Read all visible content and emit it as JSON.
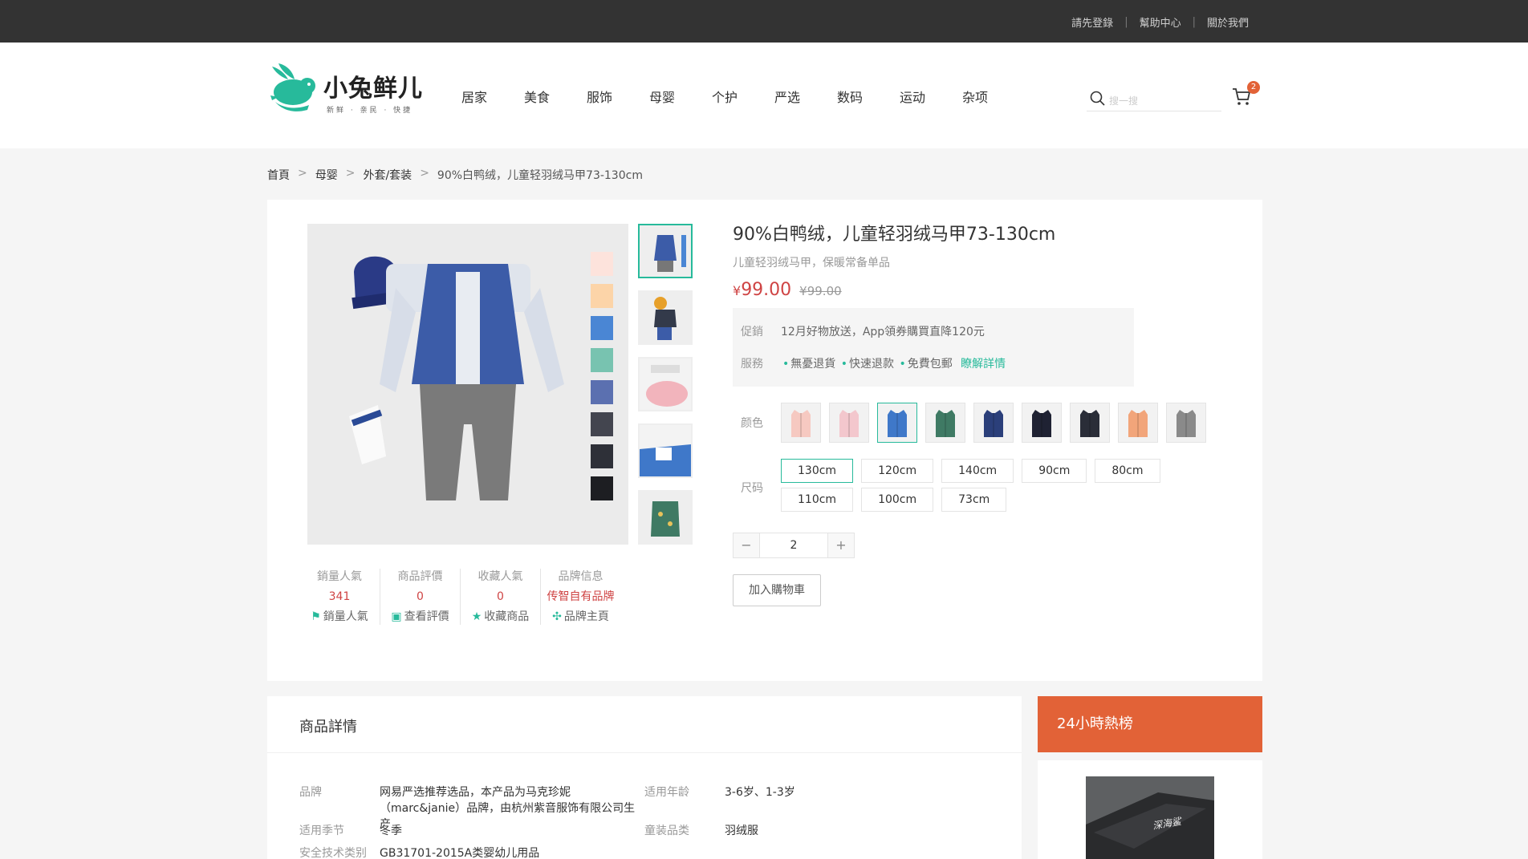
{
  "topbar": {
    "links": [
      "請先登錄",
      "幫助中心",
      "關於我們"
    ]
  },
  "header": {
    "logo": {
      "text": "小兔鲜儿",
      "tagline": "新鲜 · 亲民 · 快捷"
    },
    "nav": [
      "居家",
      "美食",
      "服饰",
      "母婴",
      "个护",
      "严选",
      "数码",
      "运动",
      "杂项"
    ],
    "search_placeholder": "搜一搜",
    "cart_count": "2"
  },
  "breadcrumb": [
    "首頁",
    "母婴",
    "外套/套装",
    "90%白鸭绒，儿童轻羽绒马甲73-130cm"
  ],
  "product": {
    "title": "90%白鸭绒，儿童轻羽绒马甲73-130cm",
    "desc": "儿童轻羽绒马甲，保暖常备单品",
    "price_symbol": "¥",
    "price": "99.00",
    "old_price": "¥99.00",
    "promo_label": "促銷",
    "promo_text": "12月好物放送，App領券購買直降120元",
    "service_label": "服務",
    "services": [
      "無憂退貨",
      "快速退款",
      "免費包郵"
    ],
    "service_more": "瞭解詳情",
    "color_label": "颜色",
    "colors": [
      "#f6c9c1",
      "#f3c7cd",
      "#3f78c9",
      "#3f7a64",
      "#2b3f7a",
      "#1f2233",
      "#2a2d38",
      "#f2a57a",
      "#8a8a8a"
    ],
    "size_label": "尺码",
    "sizes": [
      "130cm",
      "120cm",
      "140cm",
      "90cm",
      "80cm",
      "110cm",
      "100cm",
      "73cm"
    ],
    "quantity": "2",
    "qty_minus": "−",
    "qty_plus": "+",
    "add_cart": "加入購物車"
  },
  "stats": [
    {
      "label": "銷量人氣",
      "value": "341",
      "action": "銷量人氣",
      "icon": "flag-icon"
    },
    {
      "label": "商品評價",
      "value": "0",
      "action": "查看評價",
      "icon": "comment-icon"
    },
    {
      "label": "收藏人氣",
      "value": "0",
      "action": "收藏商品",
      "icon": "star-icon"
    },
    {
      "label": "品牌信息",
      "value": "传智自有品牌",
      "action": "品牌主頁",
      "icon": "brand-icon"
    }
  ],
  "swatch_strip": [
    "#fde3dc",
    "#fcd4a8",
    "#4a86d4",
    "#78c3b0",
    "#5b70b0",
    "#43454f",
    "#2e3038",
    "#1d1e22"
  ],
  "detail": {
    "title": "商品詳情",
    "attrs": [
      {
        "k": "品牌",
        "v": "网易严选推荐选品，本产品为马克珍妮（marc&janie）品牌，由杭州紫音服饰有限公司生产"
      },
      {
        "k": "适用年龄",
        "v": "3-6岁、1-3岁"
      },
      {
        "k": "适用季节",
        "v": "冬季"
      },
      {
        "k": "童装品类",
        "v": "羽绒服"
      },
      {
        "k": "安全技术类别",
        "v": "GB31701-2015A类婴幼儿用品"
      }
    ]
  },
  "hot": {
    "title": "24小時熱榜",
    "img_text": "深海鲨"
  }
}
